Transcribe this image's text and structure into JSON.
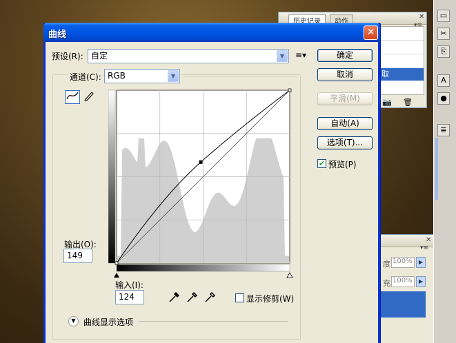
{
  "dialog": {
    "title": "曲线",
    "close": "✕",
    "preset_label": "预设(R):",
    "preset_value": "自定",
    "channel_label": "通道(C):",
    "channel_value": "RGB",
    "output_label": "输出(O):",
    "output_value": "149",
    "input_label": "输入(I):",
    "input_value": "124",
    "show_clipping_label": "显示修剪(W)",
    "show_clipping_checked": false,
    "display_options_label": "曲线显示选项",
    "buttons": {
      "ok": "确定",
      "cancel": "取消",
      "smooth": "平滑(M)",
      "auto": "自动(A)",
      "options": "选项(T)..."
    },
    "preview_label": "预览(P)",
    "preview_checked": true
  },
  "curve": {
    "input": 124,
    "output": 149
  },
  "background_panels": {
    "history_tabs": [
      "历史记录",
      "动作"
    ],
    "layer_opacity_label": "度:",
    "layer_opacity_value": "100%",
    "layer_fill_label": "充:",
    "layer_fill_value": "100%",
    "partial_tab_char": "取"
  },
  "colors": {
    "titlebar": "#0054e3",
    "dialog_bg": "#ece9d8",
    "histogram": "#d0d0d0",
    "selection": "#316ac5"
  }
}
